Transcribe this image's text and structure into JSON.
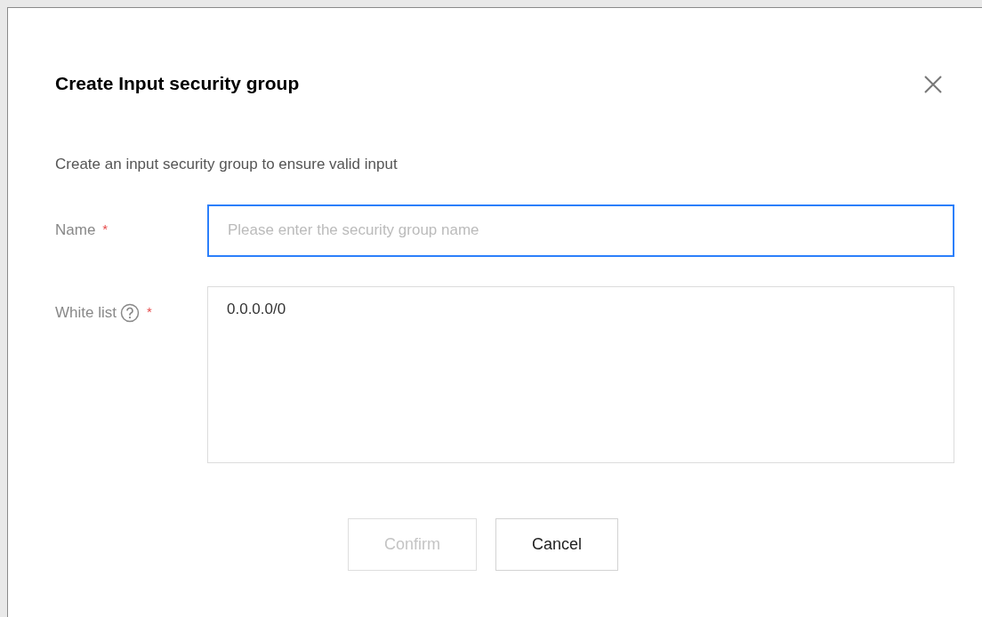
{
  "dialog": {
    "title": "Create Input security group",
    "description": "Create an input security group to ensure valid input"
  },
  "fields": [
    {
      "kind": "input",
      "label": "Name",
      "required_mark": "*",
      "focused": true,
      "placeholder": "Please enter the security group name"
    },
    {
      "kind": "textarea",
      "label": "White list",
      "required_mark": "*",
      "help": true,
      "focused": false,
      "value": "0.0.0.0/0"
    }
  ],
  "buttons": [
    {
      "label": "Confirm",
      "disabled": true
    },
    {
      "label": "Cancel",
      "disabled": false
    }
  ]
}
